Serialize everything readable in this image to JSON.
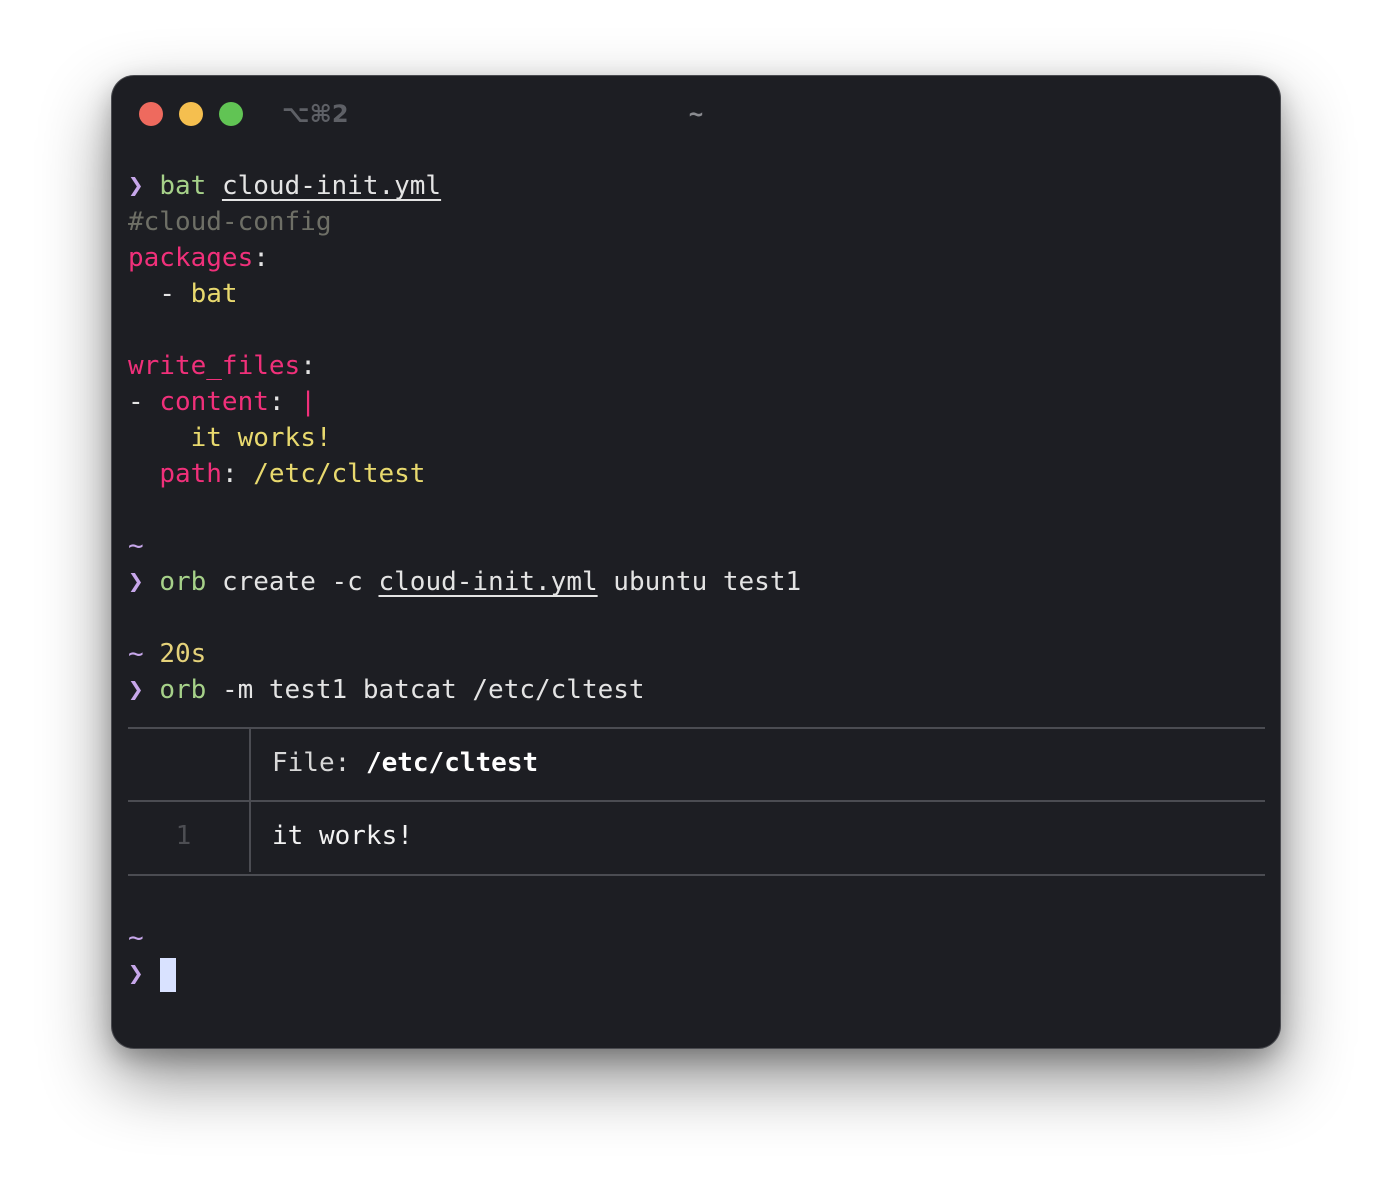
{
  "window": {
    "shortcut": "⌥⌘2",
    "title": "~"
  },
  "terminal": {
    "prompt_symbol": "❯",
    "cwd": "~",
    "cmd1": {
      "program": "bat",
      "file": "cloud-init.yml"
    },
    "yaml": {
      "comment": "#cloud-config",
      "packages_key": "packages",
      "colon": ":",
      "dash": "-",
      "package_item": "bat",
      "write_files_key": "write_files",
      "content_key": "content",
      "pipe": "|",
      "content_value": "it works!",
      "path_key": "path",
      "path_value": "/etc/cltest"
    },
    "cmd2": {
      "program": "orb",
      "args_before": "create -c",
      "file": "cloud-init.yml",
      "args_after": "ubuntu test1"
    },
    "cmd2_duration": "20s",
    "cmd3": {
      "program": "orb",
      "args": "-m test1 batcat /etc/cltest"
    },
    "bat_output": {
      "file_label": "File:",
      "file_path": "/etc/cltest",
      "line_number": "1",
      "line_content": "it works!"
    }
  },
  "colors": {
    "background": "#1d1e23",
    "prompt": "#c7a7ea",
    "command": "#a6d189",
    "yaml_key": "#f0307a",
    "yaml_value": "#e8d96e",
    "comment": "#6e6f66",
    "cursor": "#d9e2ff"
  }
}
